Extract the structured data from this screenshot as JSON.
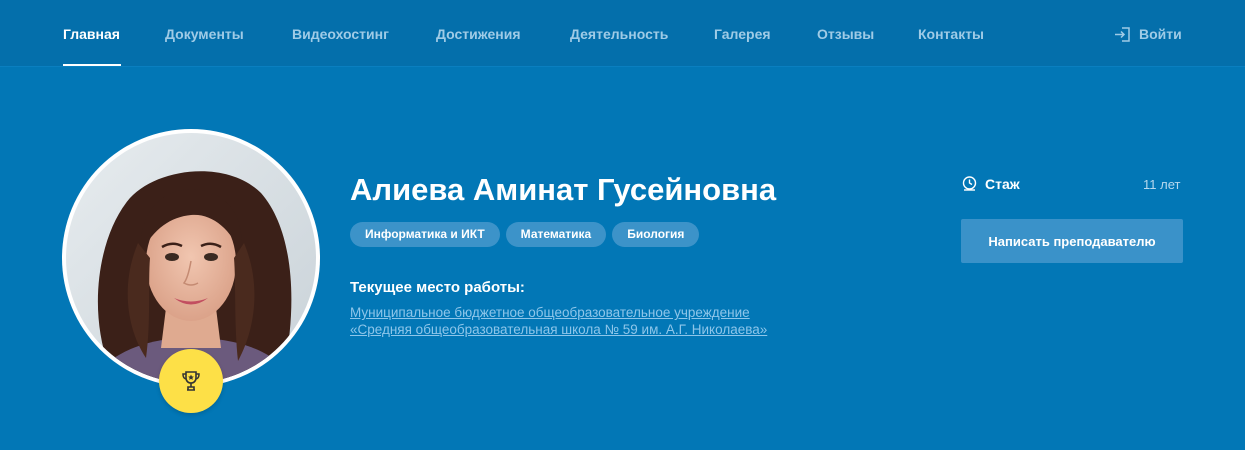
{
  "nav": {
    "items": [
      {
        "label": "Главная",
        "active": true
      },
      {
        "label": "Документы"
      },
      {
        "label": "Видеохостинг"
      },
      {
        "label": "Достижения"
      },
      {
        "label": "Деятельность"
      },
      {
        "label": "Галерея"
      },
      {
        "label": "Отзывы"
      },
      {
        "label": "Контакты"
      }
    ],
    "login_label": "Войти",
    "login_icon": "login-icon"
  },
  "profile": {
    "name": "Алиева Аминат Гусейновна",
    "subjects": [
      "Информатика и ИКТ",
      "Математика",
      "Биология"
    ],
    "work_label": "Текущее место работы:",
    "work_place_line1": "Муниципальное бюджетное общеобразовательное учреждение",
    "work_place_line2": "«Средняя общеобразовательная школа № 59 им. А.Г. Николаева»",
    "badge_icon": "trophy-icon"
  },
  "experience": {
    "label": "Стаж",
    "value": "11 лет",
    "icon": "clock-icon"
  },
  "contact_button_label": "Написать преподавателю",
  "colors": {
    "background": "#0277b6",
    "nav_background": "#046fab",
    "nav_inactive": "#9fcbe6",
    "tag_background": "#3c93c9",
    "badge": "#fde047",
    "link": "#8ec6ea"
  }
}
